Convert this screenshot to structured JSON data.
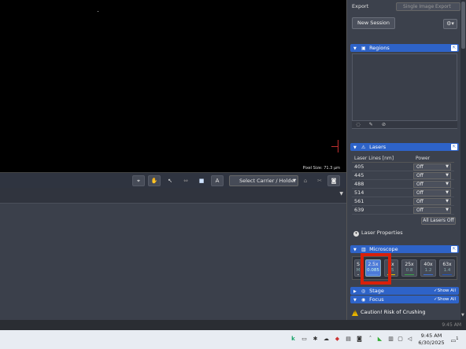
{
  "image_view": {
    "pixel_size": "Pixel Size: 71.3 µm"
  },
  "toolbar": {
    "tools": [
      {
        "icon": "crosshair-icon",
        "glyph": "⌖"
      },
      {
        "icon": "hand-icon",
        "glyph": "✋"
      },
      {
        "icon": "pointer-icon",
        "glyph": "↖"
      },
      {
        "icon": "range-icon",
        "glyph": "⇔"
      },
      {
        "icon": "color-icon",
        "glyph": "■"
      },
      {
        "icon": "text-icon",
        "glyph": "A"
      }
    ],
    "carrier_select": "Select Carrier / Holder",
    "right_icons": [
      {
        "icon": "carrier-icon",
        "glyph": "⌂"
      },
      {
        "icon": "scissors-icon",
        "glyph": "✂"
      },
      {
        "icon": "camera-icon",
        "glyph": "◙"
      }
    ]
  },
  "right_panel": {
    "export_label": "Export",
    "export_select": "Single Image Export",
    "new_session": "New Session",
    "gear_glyph": "⚙▾",
    "sections": {
      "regions": "Regions",
      "lasers": "Lasers",
      "microscope": "Microscope",
      "stage": "Stage",
      "focus": "Focus"
    },
    "show_all": "✓Show All",
    "regions_tools": [
      "◌",
      "✎",
      "⊘"
    ],
    "laser_table": {
      "headers": [
        "Laser Lines [nm]",
        "Power"
      ],
      "rows": [
        {
          "wl": "405",
          "power": "Off"
        },
        {
          "wl": "445",
          "power": "Off"
        },
        {
          "wl": "488",
          "power": "Off"
        },
        {
          "wl": "514",
          "power": "Off"
        },
        {
          "wl": "561",
          "power": "Off"
        },
        {
          "wl": "639",
          "power": "Off"
        }
      ]
    },
    "all_lasers_off": "All Lasers Off",
    "laser_properties": "Laser Properties",
    "objectives": [
      {
        "mag": "S",
        "na": "M",
        "bar": "#aaaaaa"
      },
      {
        "mag": "2.5x",
        "na": "0.085",
        "bar": "#5d8fe0",
        "selected": true
      },
      {
        "mag": "0x",
        "na": "45",
        "bar": "#e6c200"
      },
      {
        "mag": "25x",
        "na": "0.8",
        "bar": "#3aa64a"
      },
      {
        "mag": "40x",
        "na": "1.2",
        "bar": "#3b6fd6"
      },
      {
        "mag": "63x",
        "na": "1.4",
        "bar": "#2255bb"
      }
    ],
    "caution": "Caution! Risk of Crushing"
  },
  "status": {
    "time": "9:45 AM"
  },
  "taskbar": {
    "time": "9:45 AM",
    "date": "6/30/2025",
    "notification_count": "1"
  },
  "colors": {
    "accent_blue": "#2e63c8",
    "highlight_red": "#d8200a"
  }
}
